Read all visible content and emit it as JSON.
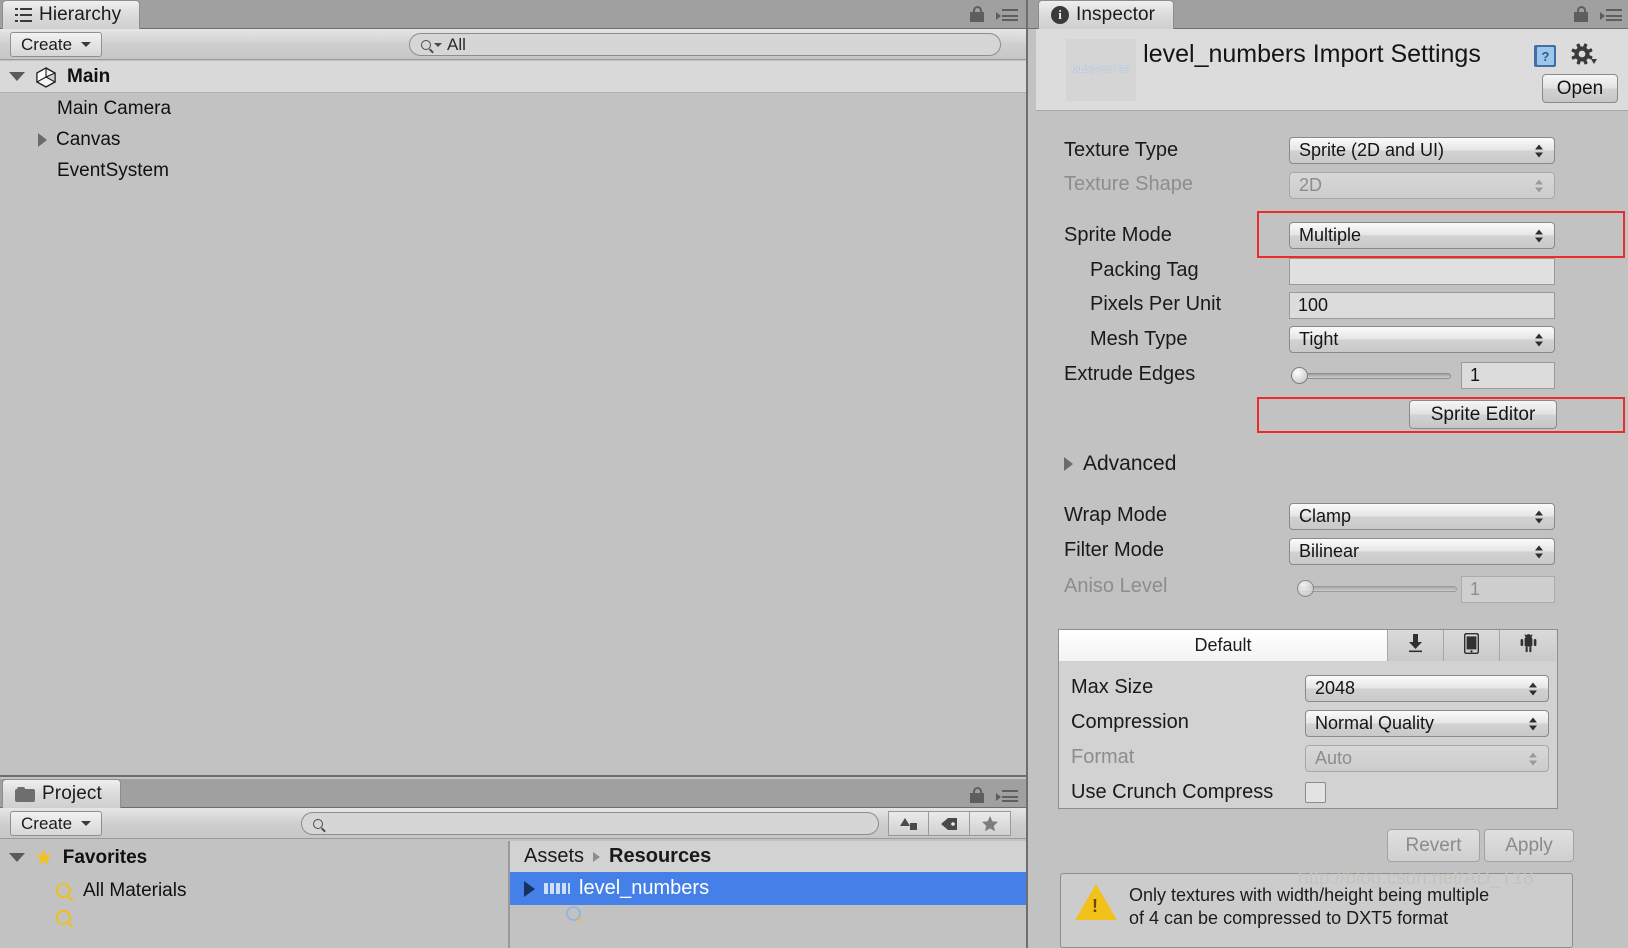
{
  "hierarchy": {
    "tab_label": "Hierarchy",
    "tab_icon": "hierarchy-icon",
    "create_label": "Create",
    "search_value": "All",
    "items": [
      {
        "label": "Main",
        "depth": 0,
        "expanded": true,
        "icon": "unity-scene-icon",
        "bold": true
      },
      {
        "label": "Main Camera",
        "depth": 1,
        "expanded": null,
        "icon": "",
        "bold": false
      },
      {
        "label": "Canvas",
        "depth": 1,
        "expanded": false,
        "icon": "",
        "bold": false
      },
      {
        "label": "EventSystem",
        "depth": 1,
        "expanded": null,
        "icon": "",
        "bold": false
      }
    ]
  },
  "inspector": {
    "tab_label": "Inspector",
    "tab_icon": "info-icon",
    "title": "level_numbers Import Settings",
    "preview_digits": "0123456789",
    "help_icon": "help-book-icon",
    "gear_icon": "gear-icon",
    "open_label": "Open",
    "fields": [
      {
        "label": "Texture Type",
        "value": "Sprite (2D and UI)",
        "kind": "dropdown",
        "disabled": false,
        "indent": 0
      },
      {
        "label": "Texture Shape",
        "value": "2D",
        "kind": "dropdown",
        "disabled": true,
        "indent": 0
      },
      {
        "label": "Sprite Mode",
        "value": "Multiple",
        "kind": "dropdown",
        "disabled": false,
        "indent": 0,
        "highlighted": true
      },
      {
        "label": "Packing Tag",
        "value": "",
        "kind": "text",
        "disabled": false,
        "indent": 1
      },
      {
        "label": "Pixels Per Unit",
        "value": "100",
        "kind": "text",
        "disabled": false,
        "indent": 1
      },
      {
        "label": "Mesh Type",
        "value": "Tight",
        "kind": "dropdown",
        "disabled": false,
        "indent": 1
      },
      {
        "label": "Extrude Edges",
        "value": "1",
        "kind": "slider",
        "disabled": false,
        "indent": 1,
        "slider_pct": 0
      }
    ],
    "sprite_editor_label": "Sprite Editor",
    "advanced_label": "Advanced",
    "advanced_expanded": false,
    "fields2": [
      {
        "label": "Wrap Mode",
        "value": "Clamp",
        "kind": "dropdown",
        "disabled": false
      },
      {
        "label": "Filter Mode",
        "value": "Bilinear",
        "kind": "dropdown",
        "disabled": false
      },
      {
        "label": "Aniso Level",
        "value": "1",
        "kind": "slider",
        "disabled": true,
        "slider_pct": 0
      }
    ],
    "platform": {
      "tabs": [
        {
          "label": "Default",
          "icon": "",
          "active": true
        },
        {
          "label": "",
          "icon": "standalone-download-icon",
          "active": false
        },
        {
          "label": "",
          "icon": "iphone-icon",
          "active": false
        },
        {
          "label": "",
          "icon": "android-icon",
          "active": false
        }
      ],
      "rows": [
        {
          "label": "Max Size",
          "value": "2048",
          "kind": "dropdown",
          "disabled": false
        },
        {
          "label": "Compression",
          "value": "Normal Quality",
          "kind": "dropdown",
          "disabled": false
        },
        {
          "label": "Format",
          "value": "Auto",
          "kind": "dropdown",
          "disabled": true
        },
        {
          "label": "Use Crunch Compress",
          "value": false,
          "kind": "checkbox",
          "disabled": false
        }
      ]
    },
    "revert_label": "Revert",
    "apply_label": "Apply",
    "warning_line1": "Only textures with width/height being multiple",
    "warning_line2": "of 4 can be compressed to DXT5 format",
    "watermark": "http://blog.csdn.net/AD_T18"
  },
  "project": {
    "tab_label": "Project",
    "tab_icon": "folder-icon",
    "create_label": "Create",
    "search_value": "",
    "favorites": {
      "label": "Favorites",
      "expanded": true,
      "items": [
        {
          "label": "All Materials",
          "icon": "saved-search-icon"
        }
      ]
    },
    "breadcrumb": [
      "Assets",
      "Resources"
    ],
    "rows": [
      {
        "label": "level_numbers",
        "selected": true,
        "expandable": true,
        "icon": "sprite-sheet-icon"
      }
    ],
    "toolbar_icons": [
      "new-asset-icon",
      "label-tag-icon",
      "favorite-star-icon"
    ]
  },
  "colors": {
    "selection_blue": "#4580e8",
    "highlight_red": "#ec2c2c",
    "panel_bg": "#c2c2c2",
    "chrome_gray": "#a0a0a0",
    "star_yellow": "#f2c21a"
  }
}
